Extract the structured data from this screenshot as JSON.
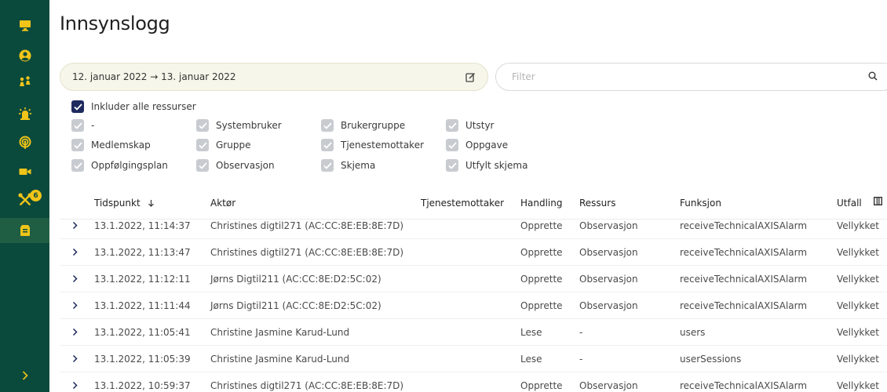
{
  "sidebar": {
    "items": [
      {
        "icon": "monitor-icon"
      },
      {
        "icon": "user-circle-icon"
      },
      {
        "icon": "people-icon"
      },
      {
        "icon": "alarm-icon"
      },
      {
        "icon": "signal-icon"
      },
      {
        "icon": "video-camera-icon"
      },
      {
        "icon": "tools-icon",
        "badge": "6"
      },
      {
        "icon": "log-icon"
      }
    ]
  },
  "page": {
    "title": "Innsynslogg"
  },
  "date_range": {
    "value": "12. januar 2022 → 13. januar 2022"
  },
  "filter": {
    "placeholder": "Filter"
  },
  "include_all": {
    "label": "Inkluder alle ressurser",
    "checked": true
  },
  "resources": [
    "-",
    "Systembruker",
    "Brukergruppe",
    "Utstyr",
    "Medlemskap",
    "Gruppe",
    "Tjenestemottaker",
    "Oppgave",
    "Oppfølgingsplan",
    "Observasjon",
    "Skjema",
    "Utfylt skjema"
  ],
  "table": {
    "columns": {
      "time": "Tidspunkt",
      "actor": "Aktør",
      "recipient": "Tjenestemottaker",
      "action": "Handling",
      "resource": "Ressurs",
      "function": "Funksjon",
      "outcome": "Utfall"
    },
    "rows": [
      {
        "time": "13.1.2022, 11:14:37",
        "actor": "Christines digtil271 (AC:CC:8E:EB:8E:7D)",
        "recipient": "",
        "action": "Opprette",
        "resource": "Observasjon",
        "function": "receiveTechnicalAXISAlarm",
        "outcome": "Vellykket"
      },
      {
        "time": "13.1.2022, 11:13:47",
        "actor": "Christines digtil271 (AC:CC:8E:EB:8E:7D)",
        "recipient": "",
        "action": "Opprette",
        "resource": "Observasjon",
        "function": "receiveTechnicalAXISAlarm",
        "outcome": "Vellykket"
      },
      {
        "time": "13.1.2022, 11:12:11",
        "actor": "Jørns Digtil211 (AC:CC:8E:D2:5C:02)",
        "recipient": "",
        "action": "Opprette",
        "resource": "Observasjon",
        "function": "receiveTechnicalAXISAlarm",
        "outcome": "Vellykket"
      },
      {
        "time": "13.1.2022, 11:11:44",
        "actor": "Jørns Digtil211 (AC:CC:8E:D2:5C:02)",
        "recipient": "",
        "action": "Opprette",
        "resource": "Observasjon",
        "function": "receiveTechnicalAXISAlarm",
        "outcome": "Vellykket"
      },
      {
        "time": "13.1.2022, 11:05:41",
        "actor": "Christine Jasmine Karud-Lund",
        "recipient": "",
        "action": "Lese",
        "resource": "-",
        "function": "users",
        "outcome": "Vellykket"
      },
      {
        "time": "13.1.2022, 11:05:39",
        "actor": "Christine Jasmine Karud-Lund",
        "recipient": "",
        "action": "Lese",
        "resource": "-",
        "function": "userSessions",
        "outcome": "Vellykket"
      },
      {
        "time": "13.1.2022, 10:59:37",
        "actor": "Christines digtil271 (AC:CC:8E:EB:8E:7D)",
        "recipient": "",
        "action": "Opprette",
        "resource": "Observasjon",
        "function": "receiveTechnicalAXISAlarm",
        "outcome": "Vellykket"
      }
    ]
  },
  "colors": {
    "sidebar_bg": "#0a4a3c",
    "sidebar_icon": "#f0c419",
    "checkbox_checked": "#1e2a5e",
    "checkbox_muted": "#c8cbd0",
    "row_expander": "#1e2a5e"
  }
}
